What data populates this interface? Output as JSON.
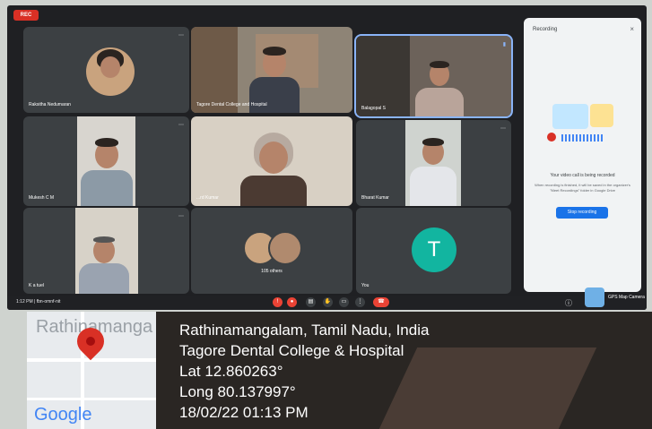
{
  "meeting": {
    "rec_badge": "REC",
    "tiles": [
      {
        "name": "Raksitha Nedumaran"
      },
      {
        "name": "Tagore Dental College and Hospital"
      },
      {
        "name": "Balagopal S"
      },
      {
        "name": "Mukesh C M"
      },
      {
        "name": "...rd Kumar"
      },
      {
        "name": "Bharat Kumar"
      },
      {
        "name": "K a tuel"
      },
      {
        "name": "You",
        "initial": "T"
      }
    ],
    "others_label": "105 others",
    "time_label": "1:12 PM  |  fbn-omnf-nit"
  },
  "recording_panel": {
    "title": "Recording",
    "heading": "Your video call is being recorded",
    "sub": "When recording is finished, it will be saved in the organizer's \"Meet Recordings\" folder in Google Drive",
    "stop_label": "Stop recording"
  },
  "gps": {
    "map_label": "Rathinamanga",
    "google_label": "Google",
    "line1": "Rathinamangalam, Tamil Nadu, India",
    "line2": "Tagore Dental College & Hospital",
    "lat": "Lat 12.860263°",
    "long": "Long 80.137997°",
    "datetime": "18/02/22 01:13 PM",
    "camera_label": "GPS Map Camera"
  }
}
